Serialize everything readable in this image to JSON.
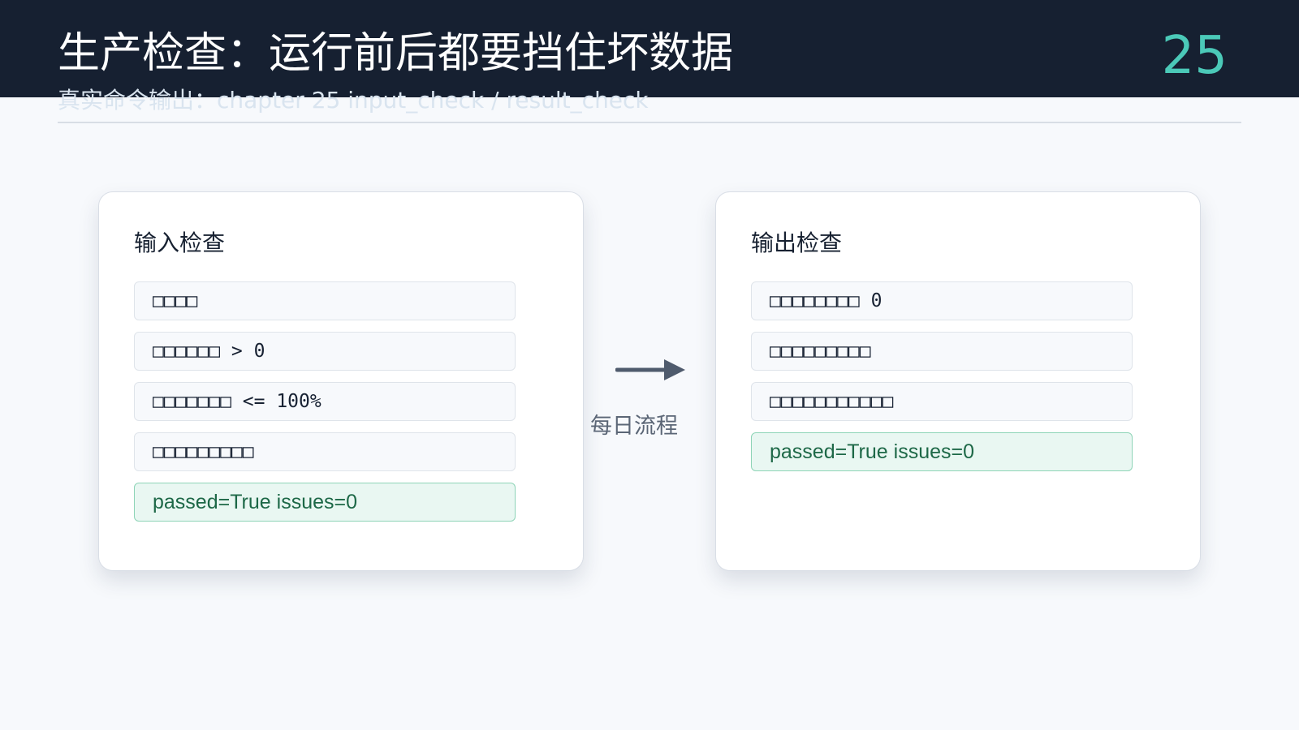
{
  "slide": {
    "title": "生产检查：运行前后都要挡住坏数据",
    "number": "25",
    "subtitle": "真实命令输出：chapter 25 input_check / result_check"
  },
  "colors": {
    "header_band": "#162031",
    "accent": "#4bc9b8",
    "success": "#1d6847",
    "success_bg": "#e9f7f2",
    "page_bg": "#f7f9fc"
  },
  "input_check": {
    "title": "输入检查",
    "items": [
      "□□□□",
      "□□□□□□ > 0",
      "□□□□□□□ <= 100%",
      "□□□□□□□□□"
    ],
    "result": "passed=True issues=0"
  },
  "connector": {
    "icon": "right-arrow-icon",
    "label": "每日流程"
  },
  "output_check": {
    "title": "输出检查",
    "items": [
      "□□□□□□□□ 0",
      "□□□□□□□□□",
      "□□□□□□□□□□□"
    ],
    "result": "passed=True issues=0"
  }
}
